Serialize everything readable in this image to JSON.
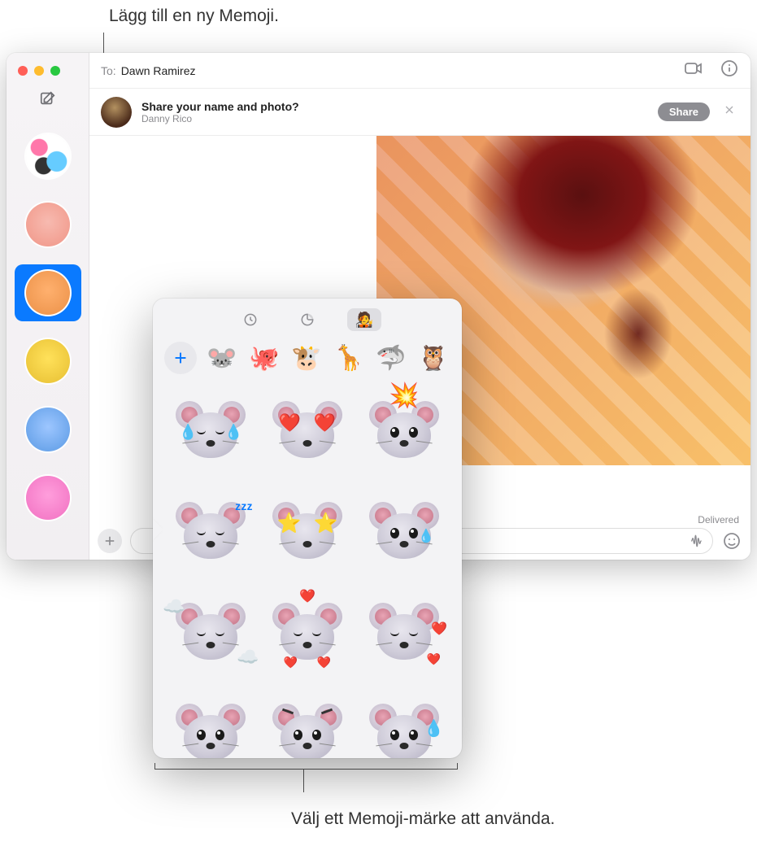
{
  "callouts": {
    "top": "Lägg till en ny Memoji.",
    "bottom": "Välj ett Memoji-märke att använda."
  },
  "header": {
    "to_label": "To:",
    "to_name": "Dawn Ramirez"
  },
  "share_banner": {
    "title": "Share your name and photo?",
    "subtitle": "Danny Rico",
    "button": "Share"
  },
  "status": {
    "delivered": "Delivered"
  },
  "input": {
    "placeholder": ""
  },
  "sidebar": {
    "conversations": [
      {
        "name": "group-chat",
        "selected": false
      },
      {
        "name": "memoji-pink",
        "selected": false
      },
      {
        "name": "memoji-orange",
        "selected": true
      },
      {
        "name": "memoji-yellow-glasses",
        "selected": false
      },
      {
        "name": "photo-man-blue",
        "selected": false
      },
      {
        "name": "photo-woman-pink",
        "selected": false
      }
    ]
  },
  "popover": {
    "tabs": [
      {
        "name": "recents",
        "active": false
      },
      {
        "name": "stickers",
        "active": false
      },
      {
        "name": "memoji",
        "active": true
      }
    ],
    "head_row": [
      {
        "name": "add",
        "icon": "plus"
      },
      {
        "name": "mouse",
        "glyph": "🐭"
      },
      {
        "name": "octopus",
        "glyph": "🐙"
      },
      {
        "name": "cow",
        "glyph": "🐮"
      },
      {
        "name": "giraffe",
        "glyph": "🦒"
      },
      {
        "name": "shark",
        "glyph": "🦈"
      },
      {
        "name": "owl",
        "glyph": "🦉"
      }
    ],
    "stickers": [
      {
        "name": "mouse-laugh-tears",
        "base": "open",
        "overlays": [
          "tears"
        ]
      },
      {
        "name": "mouse-heart-eyes",
        "base": "open",
        "overlays": [
          "hearts"
        ]
      },
      {
        "name": "mouse-mind-blown",
        "base": "open",
        "overlays": [
          "explode"
        ]
      },
      {
        "name": "mouse-sleeping",
        "base": "closed",
        "overlays": [
          "zzz"
        ]
      },
      {
        "name": "mouse-star-eyes",
        "base": "open",
        "overlays": [
          "stars"
        ]
      },
      {
        "name": "mouse-single-tear",
        "base": "open",
        "overlays": [
          "tear"
        ]
      },
      {
        "name": "mouse-clouds",
        "base": "closed",
        "overlays": [
          "clouds"
        ]
      },
      {
        "name": "mouse-blowing-kiss",
        "base": "closed",
        "overlays": [
          "kiss-hearts"
        ]
      },
      {
        "name": "mouse-shy-hearts",
        "base": "closed",
        "overlays": [
          "side-hearts"
        ]
      },
      {
        "name": "mouse-worried",
        "base": "open",
        "overlays": []
      },
      {
        "name": "mouse-angry",
        "base": "open",
        "overlays": [
          "angry"
        ]
      },
      {
        "name": "mouse-cold-sweat",
        "base": "open",
        "overlays": [
          "sweat"
        ]
      }
    ]
  }
}
